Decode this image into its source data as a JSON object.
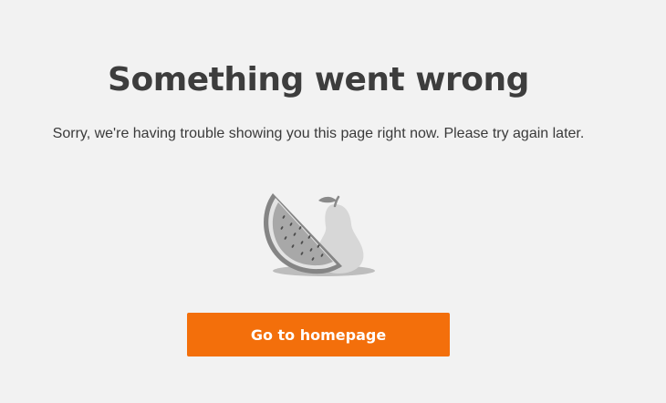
{
  "error": {
    "title": "Something went wrong",
    "message": "Sorry, we're having trouble showing you this page right now. Please try again later.",
    "illustration_icon": "fruit-illustration-icon",
    "button_label": "Go to homepage"
  },
  "colors": {
    "background": "#f2f2f2",
    "title_text": "#3d3d3d",
    "button": "#f36f0b",
    "button_text": "#ffffff"
  }
}
